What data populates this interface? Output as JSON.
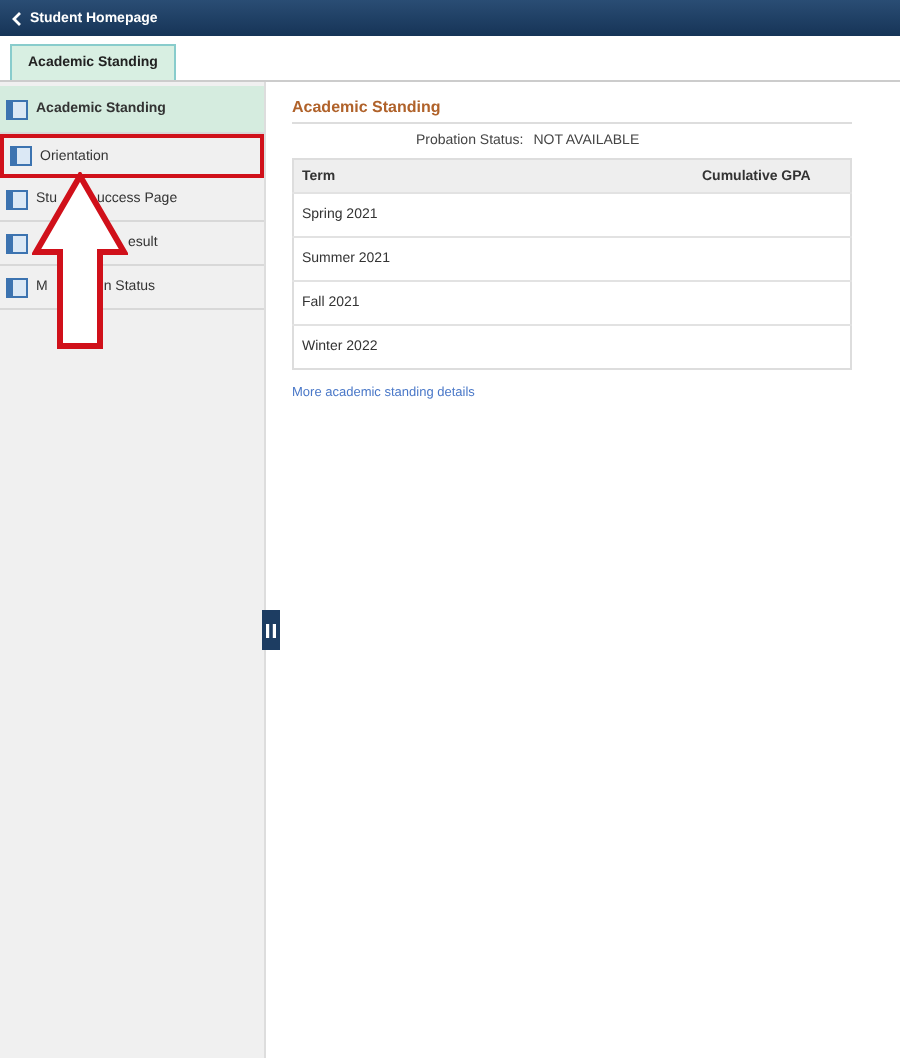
{
  "header": {
    "back_label": "Student Homepage"
  },
  "tabs": [
    {
      "label": "Academic Standing",
      "selected": true
    }
  ],
  "sidebar": {
    "items": [
      {
        "start": "Academic Standing",
        "selected": true,
        "highlighted": false
      },
      {
        "start": "Orientation",
        "selected": false,
        "highlighted": true
      },
      {
        "start": "Stu",
        "end": "uccess Page",
        "selected": false,
        "highlighted": false
      },
      {
        "end": "esult",
        "selected": false,
        "highlighted": false
      },
      {
        "start": "M",
        "end": "n Status",
        "selected": false,
        "highlighted": false
      }
    ]
  },
  "main": {
    "title": "Academic Standing",
    "probation_label": "Probation Status:",
    "probation_value": "NOT AVAILABLE",
    "table": {
      "columns": [
        "Term",
        "Cumulative GPA"
      ],
      "rows": [
        [
          "Spring 2021",
          ""
        ],
        [
          "Summer 2021",
          ""
        ],
        [
          "Fall 2021",
          ""
        ],
        [
          "Winter 2022",
          ""
        ]
      ]
    },
    "link": "More academic standing details"
  }
}
